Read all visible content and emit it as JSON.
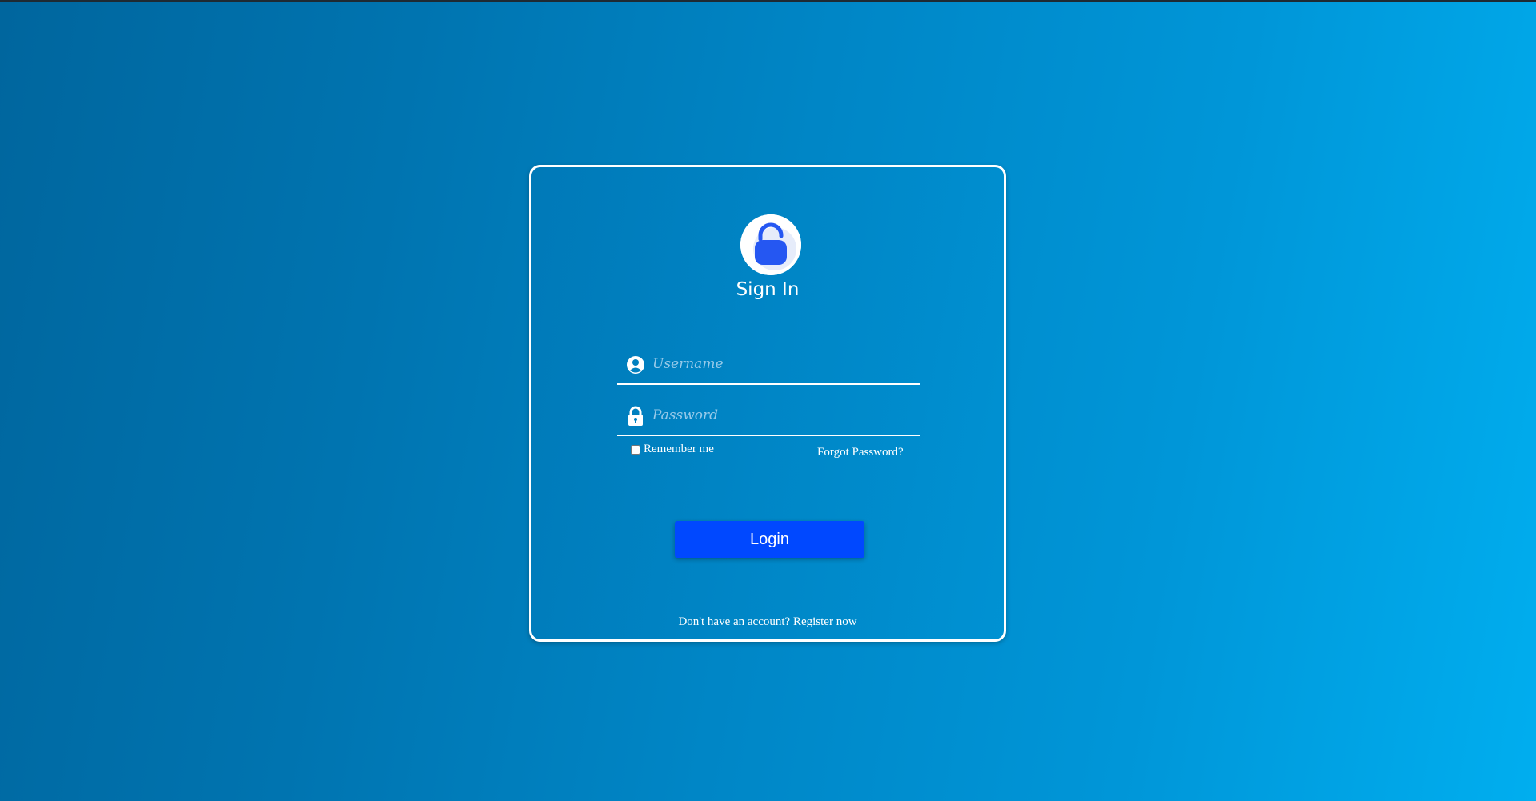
{
  "app": {
    "background_colors": [
      "#00669e",
      "#00aeef"
    ],
    "accent": "#0048ff"
  },
  "card": {
    "logo_icon": "unlock-icon",
    "title": "Sign In",
    "username": {
      "icon": "user-circle-icon",
      "placeholder": "Username",
      "value": ""
    },
    "password": {
      "icon": "lock-icon",
      "placeholder": "Password",
      "value": ""
    },
    "remember": {
      "label": "Remember me",
      "checked": false
    },
    "forgot_label": "Forgot Password?",
    "login_label": "Login",
    "register": {
      "prompt": "Don't have an account?",
      "link_label": "Register now"
    }
  }
}
